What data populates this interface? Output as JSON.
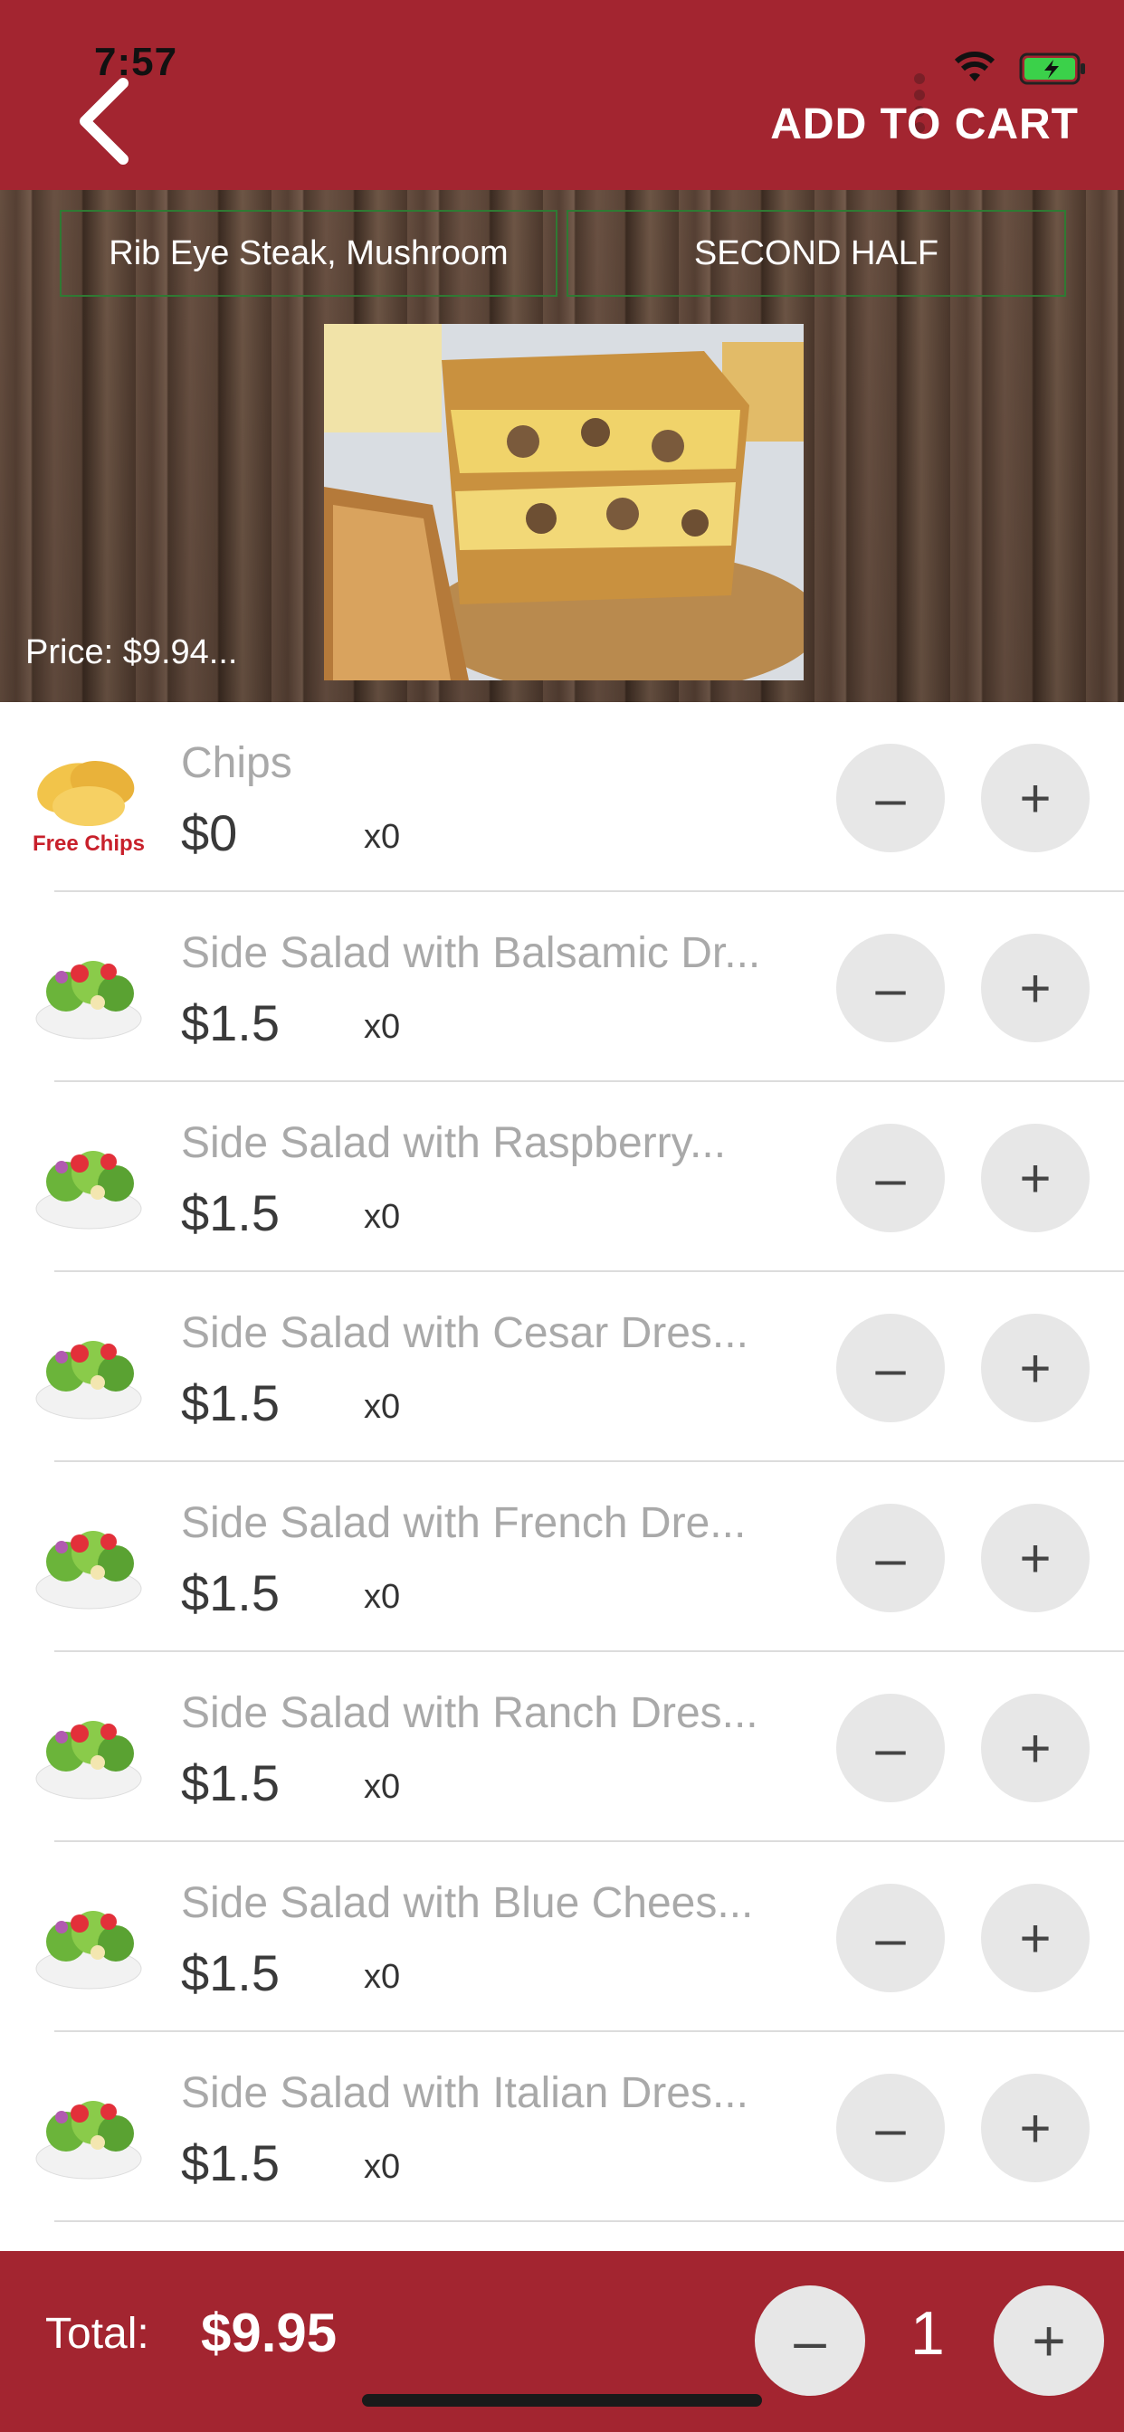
{
  "status": {
    "time": "7:57"
  },
  "header": {
    "add_to_cart_label": "ADD TO CART"
  },
  "hero": {
    "first_half_label": "Rib Eye Steak, Mushroom",
    "second_half_label": "SECOND HALF",
    "price_text": "Price: $9.94..."
  },
  "items": [
    {
      "name": "Chips",
      "price": "$0",
      "qty": "x0",
      "thumb_caption": "Free Chips",
      "thumb": "chips"
    },
    {
      "name": "Side Salad with Balsamic Dr...",
      "price": "$1.5",
      "qty": "x0",
      "thumb": "salad"
    },
    {
      "name": "Side Salad with Raspberry...",
      "price": "$1.5",
      "qty": "x0",
      "thumb": "salad"
    },
    {
      "name": "Side Salad with Cesar Dres...",
      "price": "$1.5",
      "qty": "x0",
      "thumb": "salad"
    },
    {
      "name": "Side Salad with French Dre...",
      "price": "$1.5",
      "qty": "x0",
      "thumb": "salad"
    },
    {
      "name": "Side Salad with Ranch Dres...",
      "price": "$1.5",
      "qty": "x0",
      "thumb": "salad"
    },
    {
      "name": "Side Salad with Blue Chees...",
      "price": "$1.5",
      "qty": "x0",
      "thumb": "salad"
    },
    {
      "name": "Side Salad with Italian Dres...",
      "price": "$1.5",
      "qty": "x0",
      "thumb": "salad"
    }
  ],
  "buttons": {
    "minus_symbol": "–",
    "plus_symbol": "+"
  },
  "footer": {
    "total_label": "Total:",
    "total_value": "$9.95",
    "quantity": "1"
  },
  "colors": {
    "brand": "#a32530",
    "button_bg": "#e7e7e7"
  }
}
